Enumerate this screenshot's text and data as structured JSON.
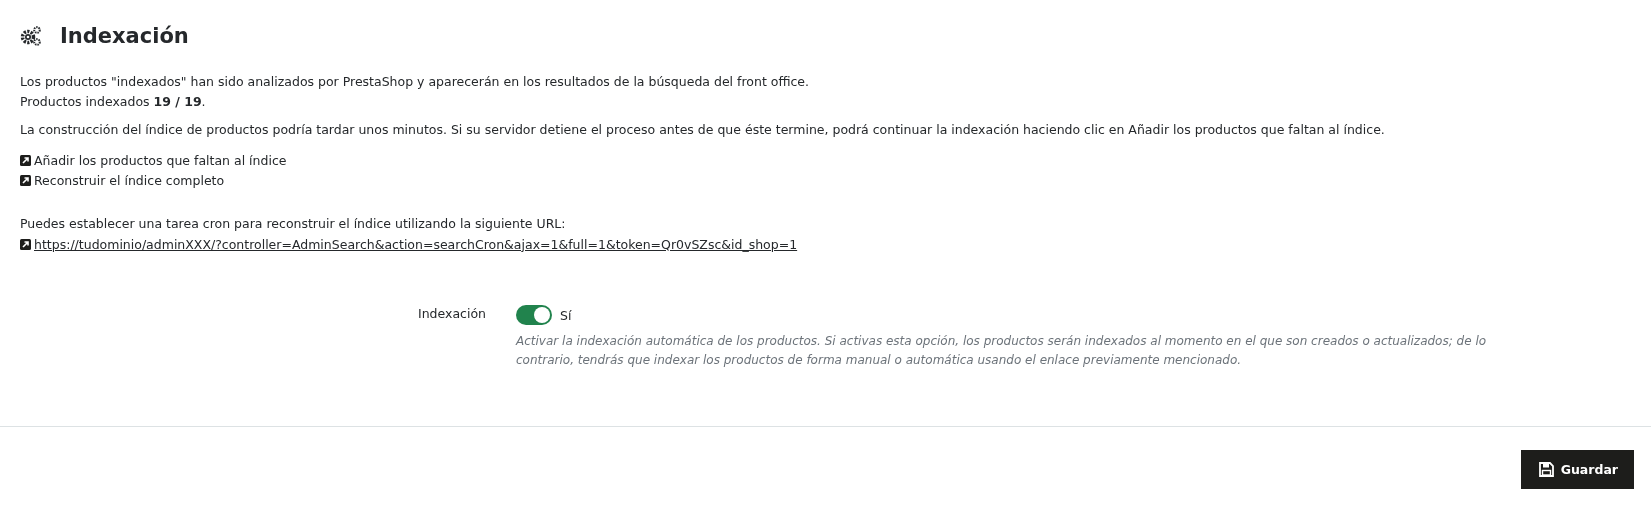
{
  "title": "Indexación",
  "intro": [
    "Los productos \"indexados\" han sido analizados por PrestaShop y aparecerán en los resultados de la búsqueda del front office.",
    "Productos indexados **19 / 19**."
  ],
  "note": "La construcción del índice de productos podría tardar unos minutos. Si su servidor detiene el proceso antes de que éste termine, podrá continuar la indexación haciendo clic en Añadir los productos que faltan al índice.",
  "links": [
    "Añadir los productos que faltan al índice",
    "Reconstruir el índice completo"
  ],
  "cron_text": "Puedes establecer una tarea cron para reconstruir el índice utilizando la siguiente URL:",
  "cron_url": "https://tudominio/adminXXX/?controller=AdminSearch&action=searchCron&ajax=1&full=1&token=Qr0vSZsc&id_shop=1",
  "setting": {
    "label": "Indexación",
    "on": true,
    "value_label": "Sí",
    "help": "Activar la indexación automática de los productos. Si activas esta opción, los productos serán indexados al momento en el que son creados o actualizados; de lo contrario, tendrás que indexar los productos de forma manual o automática usando el enlace previamente mencionado."
  },
  "save_button": "Guardar"
}
